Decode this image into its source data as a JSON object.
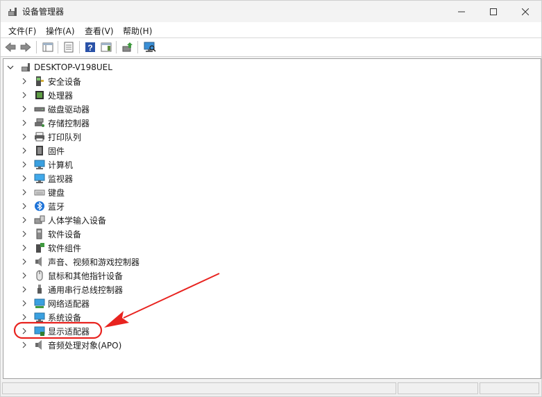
{
  "window": {
    "title": "设备管理器"
  },
  "menu": [
    {
      "label": "文件(F)"
    },
    {
      "label": "操作(A)"
    },
    {
      "label": "查看(V)"
    },
    {
      "label": "帮助(H)"
    }
  ],
  "tree": {
    "root": {
      "label": "DESKTOP-V198UEL",
      "expanded": true,
      "icon": "computer-icon"
    },
    "categories": [
      {
        "label": "安全设备",
        "icon": "security-device-icon"
      },
      {
        "label": "处理器",
        "icon": "processor-icon"
      },
      {
        "label": "磁盘驱动器",
        "icon": "disk-drive-icon"
      },
      {
        "label": "存储控制器",
        "icon": "storage-controller-icon"
      },
      {
        "label": "打印队列",
        "icon": "printer-icon"
      },
      {
        "label": "固件",
        "icon": "firmware-icon"
      },
      {
        "label": "计算机",
        "icon": "computer-icon"
      },
      {
        "label": "监视器",
        "icon": "monitor-icon"
      },
      {
        "label": "键盘",
        "icon": "keyboard-icon"
      },
      {
        "label": "蓝牙",
        "icon": "bluetooth-icon"
      },
      {
        "label": "人体学输入设备",
        "icon": "hid-icon"
      },
      {
        "label": "软件设备",
        "icon": "software-device-icon"
      },
      {
        "label": "软件组件",
        "icon": "software-component-icon"
      },
      {
        "label": "声音、视频和游戏控制器",
        "icon": "speaker-icon"
      },
      {
        "label": "鼠标和其他指针设备",
        "icon": "mouse-icon"
      },
      {
        "label": "通用串行总线控制器",
        "icon": "usb-icon"
      },
      {
        "label": "网络适配器",
        "icon": "network-adapter-icon"
      },
      {
        "label": "系统设备",
        "icon": "system-device-icon"
      },
      {
        "label": "显示适配器",
        "icon": "display-adapter-icon",
        "highlighted": true
      },
      {
        "label": "音频处理对象(APO)",
        "icon": "speaker-icon"
      }
    ]
  },
  "annotation": {
    "color": "#e8231f",
    "target": "显示适配器"
  }
}
